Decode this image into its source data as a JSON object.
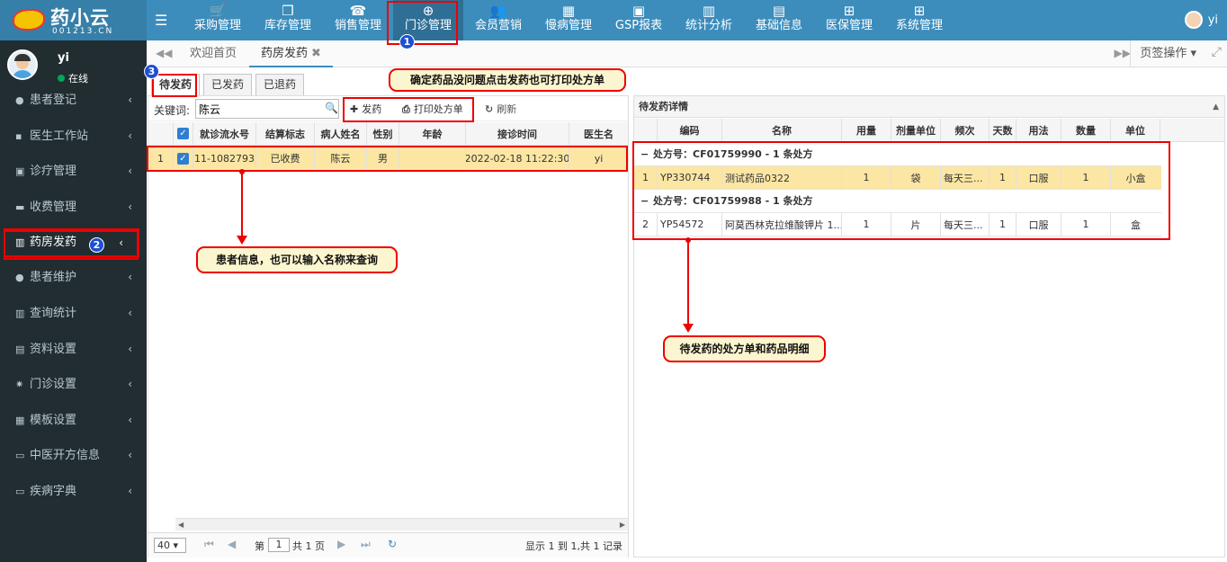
{
  "brand": {
    "name": "药小云",
    "sub": "001213.CN"
  },
  "topnav": [
    {
      "label": "采购管理",
      "icon": "cart-icon",
      "glyph": "🛒"
    },
    {
      "label": "库存管理",
      "icon": "box-icon",
      "glyph": "❒"
    },
    {
      "label": "销售管理",
      "icon": "phone-icon",
      "glyph": "☎"
    },
    {
      "label": "门诊管理",
      "icon": "medkit-icon",
      "glyph": "⊕"
    },
    {
      "label": "会员营销",
      "icon": "users-icon",
      "glyph": "👥"
    },
    {
      "label": "慢病管理",
      "icon": "hospital-icon",
      "glyph": "▦"
    },
    {
      "label": "GSP报表",
      "icon": "report-icon",
      "glyph": "▣"
    },
    {
      "label": "统计分析",
      "icon": "bar-chart-icon",
      "glyph": "▥"
    },
    {
      "label": "基础信息",
      "icon": "book-icon",
      "glyph": "▤"
    },
    {
      "label": "医保管理",
      "icon": "windows-icon",
      "glyph": "⊞"
    },
    {
      "label": "系统管理",
      "icon": "windows-icon",
      "glyph": "⊞"
    }
  ],
  "user": {
    "name": "yi",
    "status": "在线"
  },
  "sidebar": [
    {
      "label": "患者登记",
      "icon": "user-icon",
      "glyph": "●"
    },
    {
      "label": "医生工作站",
      "icon": "id-card-icon",
      "glyph": "▪"
    },
    {
      "label": "诊疗管理",
      "icon": "medkit-icon",
      "glyph": "▣"
    },
    {
      "label": "收费管理",
      "icon": "money-icon",
      "glyph": "▬"
    },
    {
      "label": "药房发药",
      "icon": "map-icon",
      "glyph": "▥"
    },
    {
      "label": "患者维护",
      "icon": "user-icon",
      "glyph": "●"
    },
    {
      "label": "查询统计",
      "icon": "bar-chart-icon",
      "glyph": "▥"
    },
    {
      "label": "资料设置",
      "icon": "file-icon",
      "glyph": "▤"
    },
    {
      "label": "门诊设置",
      "icon": "gears-icon",
      "glyph": "✷"
    },
    {
      "label": "模板设置",
      "icon": "grid-icon",
      "glyph": "▦"
    },
    {
      "label": "中医开方信息",
      "icon": "monitor-icon",
      "glyph": "▭"
    },
    {
      "label": "疾病字典",
      "icon": "monitor-icon",
      "glyph": "▭"
    }
  ],
  "tabs": {
    "home": "欢迎首页",
    "current": "药房发药",
    "page_ops": "页签操作"
  },
  "subtabs": [
    "待发药",
    "已发药",
    "已退药"
  ],
  "search": {
    "label": "关键词:",
    "value": "陈云"
  },
  "toolbar": {
    "dispense": "发药",
    "print": "打印处方单",
    "refresh": "刷新"
  },
  "left_grid": {
    "columns": [
      "就诊流水号",
      "结算标志",
      "病人姓名",
      "性别",
      "年龄",
      "接诊时间",
      "医生名"
    ],
    "rows": [
      {
        "idx": "1",
        "serial": "11-1082793",
        "settle": "已收费",
        "name": "陈云",
        "gender": "男",
        "age": "",
        "time": "2022-02-18 11:22:30",
        "doctor": "yi"
      }
    ]
  },
  "pager": {
    "size": "40",
    "page_prefix": "第",
    "page": "1",
    "page_suffix": "共 1 页",
    "info": "显示 1 到 1,共 1 记录"
  },
  "right_panel": {
    "title": "待发药详情",
    "columns": [
      "编码",
      "名称",
      "用量",
      "剂量单位",
      "频次",
      "天数",
      "用法",
      "数量",
      "单位"
    ],
    "groups": [
      {
        "label": "处方号：CF01759990 - 1 条处方",
        "rows": [
          {
            "idx": "1",
            "code": "YP330744",
            "name": "测试药品0322",
            "dose": "1",
            "dose_unit": "袋",
            "freq": "每天三...",
            "days": "1",
            "usage": "口服",
            "qty": "1",
            "unit": "小盒"
          }
        ]
      },
      {
        "label": "处方号：CF01759988 - 1 条处方",
        "rows": [
          {
            "idx": "2",
            "code": "YP54572",
            "name": "阿莫西林克拉维酸钾片 1...",
            "dose": "1",
            "dose_unit": "片",
            "freq": "每天三...",
            "days": "1",
            "usage": "口服",
            "qty": "1",
            "unit": "盒"
          }
        ]
      }
    ]
  },
  "annotations": {
    "badge1": "1",
    "badge2": "2",
    "badge3": "3",
    "callout_top": "确定药品没问题点击发药也可打印处方单",
    "callout_left": "患者信息，也可以输入名称来查询",
    "callout_right": "待发药的处方单和药品明细"
  },
  "colors": {
    "header": "#3c8dbc",
    "sidebar": "#222d32",
    "selected_row": "#fce6a4",
    "annotation": "#e00000"
  }
}
